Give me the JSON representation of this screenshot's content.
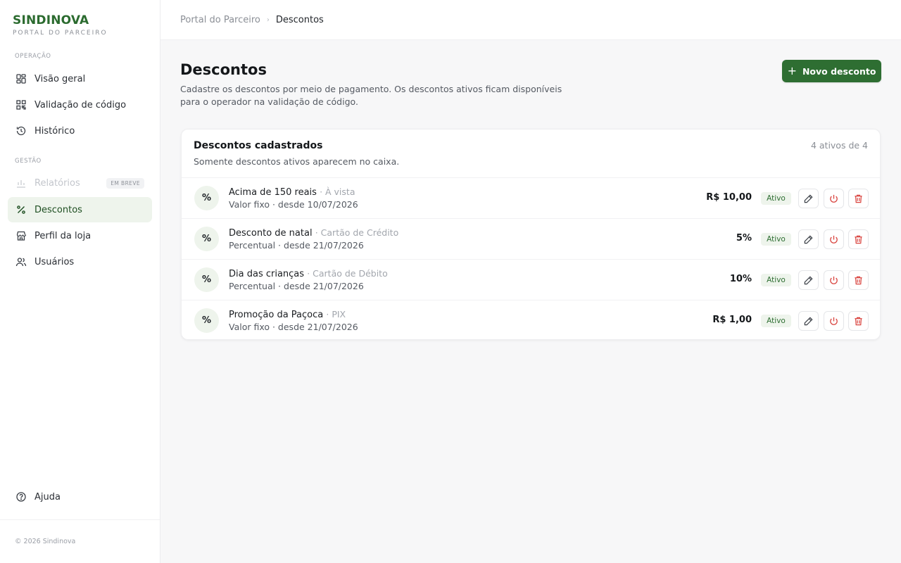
{
  "brand": {
    "name": "SINDINOVA",
    "subtitle": "PORTAL DO PARCEIRO"
  },
  "sidebar": {
    "sections": [
      {
        "label": "OPERAÇÃO"
      },
      {
        "label": "GESTÃO"
      }
    ],
    "items": [
      {
        "label": "Visão geral",
        "icon": "dashboard-grid-icon"
      },
      {
        "label": "Validação de código",
        "icon": "qr-code-icon"
      },
      {
        "label": "Histórico",
        "icon": "history-icon"
      },
      {
        "label": "Relatórios",
        "icon": "reports-icon",
        "badge": "EM BREVE",
        "disabled": true
      },
      {
        "label": "Descontos",
        "icon": "percent-icon",
        "active": true
      },
      {
        "label": "Perfil da loja",
        "icon": "store-icon"
      },
      {
        "label": "Usuários",
        "icon": "users-icon"
      }
    ],
    "help": {
      "label": "Ajuda",
      "icon": "help-circle-icon"
    },
    "copyright": "© 2026 Sindinova"
  },
  "breadcrumb": {
    "parent": "Portal do Parceiro",
    "separator": "›",
    "current": "Descontos"
  },
  "page": {
    "title": "Descontos",
    "description": "Cadastre os descontos por meio de pagamento. Os descontos ativos ficam disponíveis para o operador na validação de código.",
    "new_button": {
      "icon": "+",
      "label": "Novo desconto"
    }
  },
  "card": {
    "title": "Descontos cadastrados",
    "subtitle": "Somente descontos ativos aparecem no caixa.",
    "count": "4 ativos de 4"
  },
  "discounts": [
    {
      "icon": "%",
      "name": "Acima de 150 reais",
      "method": "· À vista",
      "meta": "Valor fixo · desde 10/07/2026",
      "value": "R$ 10,00",
      "status": "Ativo"
    },
    {
      "icon": "%",
      "name": "Desconto de natal",
      "method": "· Cartão de Crédito",
      "meta": "Percentual · desde 21/07/2026",
      "value": "5%",
      "status": "Ativo"
    },
    {
      "icon": "%",
      "name": "Dia das crianças",
      "method": "· Cartão de Débito",
      "meta": "Percentual · desde 21/07/2026",
      "value": "10%",
      "status": "Ativo"
    },
    {
      "icon": "%",
      "name": "Promoção da Paçoca",
      "method": "· PIX",
      "meta": "Valor fixo · desde 21/07/2026",
      "value": "R$ 1,00",
      "status": "Ativo"
    }
  ],
  "colors": {
    "brand": "#2b6b2f",
    "primary_button": "#2e6e32",
    "active_bg": "#eef4ec",
    "danger": "#d9443f"
  }
}
